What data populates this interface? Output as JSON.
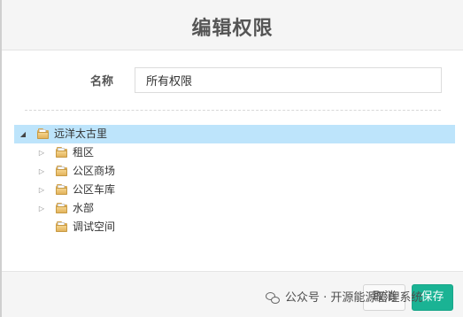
{
  "dialog": {
    "title": "编辑权限"
  },
  "form": {
    "name_label": "名称",
    "name_value": "所有权限"
  },
  "tree": {
    "nodes": [
      {
        "label": "远洋太古里",
        "level": 0,
        "state": "expanded",
        "selected": true
      },
      {
        "label": "租区",
        "level": 1,
        "state": "collapsed",
        "selected": false
      },
      {
        "label": "公区商场",
        "level": 1,
        "state": "collapsed",
        "selected": false
      },
      {
        "label": "公区车库",
        "level": 1,
        "state": "collapsed",
        "selected": false
      },
      {
        "label": "水部",
        "level": 1,
        "state": "collapsed",
        "selected": false
      },
      {
        "label": "调试空间",
        "level": 1,
        "state": "leaf",
        "selected": false
      }
    ]
  },
  "footer": {
    "cancel_label": "取消",
    "save_label": "保存"
  },
  "watermark": {
    "text": "公众号 · 开源能源管理系统"
  },
  "colors": {
    "primary": "#1ab394",
    "selected_row": "#bde4fb",
    "folder": "#e2b35c"
  }
}
